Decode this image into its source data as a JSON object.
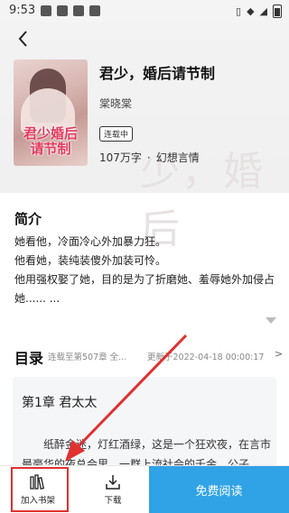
{
  "status_bar": {
    "time": "9:53"
  },
  "book": {
    "title": "君少，婚后请节制",
    "author": "棠晓棠",
    "status": "连载中",
    "word_count": "107万字",
    "genre": "幻想言情",
    "cover_title": "君少婚后请节制",
    "background_text": "少，婚后"
  },
  "intro": {
    "heading": "简介",
    "paragraphs": [
      "她看他，冷面冷心外加暴力狂。",
      "他看她，装纯装傻外加装可怜。",
      "他用强权娶了她，目的是为了折磨她、羞辱她外加侵占她...... ..."
    ]
  },
  "toc": {
    "heading": "目录",
    "subtitle": "连载至第507章 全...",
    "updated": "更新于2022-04-18 00:00:17",
    "arrow": ">"
  },
  "chapter": {
    "title": "第1章 君太太",
    "text": "纸醉金迷，灯红酒绿，这是一个狂欢夜，在言市最豪华的夜总会里，一群上流社会的千金、公子"
  },
  "bottom_bar": {
    "add_shelf_label": "加入书架",
    "download_label": "下载",
    "read_label": "免费阅读"
  },
  "colors": {
    "accent": "#2fa3e6",
    "annotation": "#e03030"
  }
}
